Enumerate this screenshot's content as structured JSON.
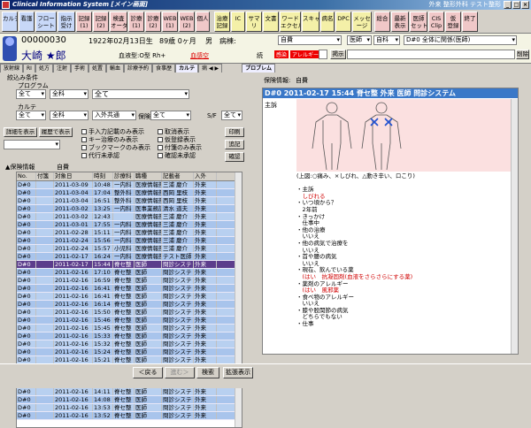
{
  "window": {
    "title": "Clinical Information System  [メイン画面]",
    "right": "外来 整形外科  テスト整形"
  },
  "toolbar": [
    {
      "label": "カルテ",
      "color": "blu"
    },
    {
      "label": "看護",
      "color": "blu"
    },
    {
      "label": "フロー\nシート",
      "color": "blu"
    },
    {
      "label": "指示\n受け",
      "color": "blu"
    },
    {
      "label": "記録\n(1)",
      "color": "pink"
    },
    {
      "label": "記録\n(2)",
      "color": "pink"
    },
    {
      "label": "検査\nオーダ",
      "color": "pink"
    },
    {
      "label": "診療\n(1)",
      "color": "pink"
    },
    {
      "label": "診療\n(2)",
      "color": "pink"
    },
    {
      "label": "WEB\n(1)",
      "color": "pink"
    },
    {
      "label": "WEB\n(2)",
      "color": "pink"
    },
    {
      "label": "個人",
      "color": "pink"
    },
    {
      "label": "治療\n記録",
      "color": "yel"
    },
    {
      "label": "IC",
      "color": "yel"
    },
    {
      "label": "サマ\nリ",
      "color": "yel"
    },
    {
      "label": "文書",
      "color": "yel"
    },
    {
      "label": "ワード\nエクセル",
      "color": "yel"
    },
    {
      "label": "スキャン",
      "color": "yel"
    },
    {
      "label": "病名",
      "color": "yel"
    },
    {
      "label": "DPC",
      "color": "yel"
    },
    {
      "label": "メッセ\nージ",
      "color": "yel"
    },
    {
      "label": "総合",
      "color": "pink"
    },
    {
      "label": "最新\n表示",
      "color": "pink"
    },
    {
      "label": "医師\nセット",
      "color": "pink"
    },
    {
      "label": "CIS\nClip",
      "color": "pink"
    },
    {
      "label": "仮\n登録",
      "color": "pink"
    },
    {
      "label": "終了",
      "color": "pink"
    }
  ],
  "patient": {
    "id": "00000030",
    "dob": "1922年02月13日生",
    "age": "89歳 0ヶ月",
    "sex": "男",
    "disease_label": "病棟:",
    "ward": "自費",
    "name": "大崎 ★郎",
    "blood": "血液型:O型 Rh+",
    "infection": "血感空",
    "warn1": "感染",
    "warn2": "アレルギー",
    "doctor": "医師",
    "dept": "自科",
    "problem": "D#0 全体に関係(医師)",
    "delete_btn": "削除",
    "extra_btn": "掲示",
    "memo_label": "続"
  },
  "tabs": [
    "放射線",
    "RI",
    "処方",
    "注射",
    "手術",
    "処置",
    "輸血",
    "診療予約",
    "食事歴",
    "カルテ",
    "病 ◀ ▶",
    "プロブレム"
  ],
  "left": {
    "filter_label": "絞込み条件",
    "program_label": "プログラム",
    "sel_all": "全て",
    "sel_dept": "全科",
    "sel_all2": "全て",
    "karte_label": "カルテ",
    "k_all": "全て",
    "k_dept": "全科",
    "k_io": "入外共通",
    "insurance_label": "保険",
    "ins_all": "全て",
    "sf_label": "S/F",
    "sf_all": "全て",
    "detail_btn": "詳細を表示",
    "history_btn": "履歴で表示",
    "print_btn": "印刷",
    "add_btn": "追記",
    "confirm_btn": "確認",
    "checks": [
      "手入力記載のみ表示",
      "キー治療のみ表示",
      "ブックマークのみ表示",
      "代行未承認",
      "取消表示",
      "仮登録表示",
      "付箋のみ表示",
      "確認未承認"
    ],
    "insurance_info": "▲保険情報",
    "insurance_value": "自費",
    "grid_headers": [
      "No.",
      "付箋",
      "対象日",
      "時刻",
      "診療科",
      "職種",
      "記載者",
      "入外"
    ],
    "rows": [
      [
        "D#0",
        "",
        "2011-03-09",
        "10:48",
        "一内科",
        "医療情報部",
        "三浦 慶介",
        "外来"
      ],
      [
        "D#0",
        "",
        "2011-03-04",
        "17:04",
        "整外科",
        "医療情報部",
        "西岡 里枝",
        "外来"
      ],
      [
        "D#0",
        "",
        "2011-03-04",
        "16:51",
        "整外科",
        "医療情報部",
        "西岡 里枝",
        "外来"
      ],
      [
        "D#0",
        "",
        "2011-03-02",
        "13:25",
        "一内科",
        "医事業務課",
        "清水 道夫",
        "外来"
      ],
      [
        "D#0",
        "",
        "2011-03-02",
        "12:43",
        "",
        "医療情報部",
        "三浦 慶介",
        "外来"
      ],
      [
        "D#0",
        "",
        "2011-03-01",
        "17:55",
        "一内科",
        "医療情報部",
        "三浦 慶介",
        "外来"
      ],
      [
        "D#0",
        "",
        "2011-02-28",
        "15:11",
        "一内科",
        "医療情報部",
        "三浦 慶介",
        "外来"
      ],
      [
        "D#0",
        "",
        "2011-02-24",
        "15:56",
        "一内科",
        "医療情報部",
        "三浦 慶介",
        "外来"
      ],
      [
        "D#0",
        "",
        "2011-02-24",
        "15:57",
        "小児科",
        "医療情報部",
        "三浦 慶介",
        "外来"
      ],
      [
        "D#0",
        "",
        "2011-02-17",
        "16:24",
        "一内科",
        "医療情報部",
        "テスト医師",
        "外来"
      ],
      [
        "D#0",
        "",
        "2011-02-17",
        "15:44",
        "脊セ整",
        "医師",
        "問診システ",
        "外来"
      ],
      [
        "D#0",
        "",
        "2011-02-16",
        "17:10",
        "脊セ整",
        "医師",
        "問診システ",
        "外来"
      ],
      [
        "D#0",
        "",
        "2011-02-16",
        "16:59",
        "脊セ整",
        "医師",
        "問診システ",
        "外来"
      ],
      [
        "D#0",
        "",
        "2011-02-16",
        "16:41",
        "脊セ整",
        "医師",
        "問診システ",
        "外来"
      ],
      [
        "D#0",
        "",
        "2011-02-16",
        "16:41",
        "脊セ整",
        "医師",
        "問診システ",
        "外来"
      ],
      [
        "D#0",
        "",
        "2011-02-16",
        "16:14",
        "脊セ整",
        "医師",
        "問診システ",
        "外来"
      ],
      [
        "D#0",
        "",
        "2011-02-16",
        "15:50",
        "脊セ整",
        "医師",
        "問診システ",
        "外来"
      ],
      [
        "D#0",
        "",
        "2011-02-16",
        "15:46",
        "脊セ整",
        "医師",
        "問診システ",
        "外来"
      ],
      [
        "D#0",
        "",
        "2011-02-16",
        "15:45",
        "脊セ整",
        "医師",
        "問診システ",
        "外来"
      ],
      [
        "D#0",
        "",
        "2011-02-16",
        "15:33",
        "脊セ整",
        "医師",
        "問診システ",
        "外来"
      ],
      [
        "D#0",
        "",
        "2011-02-16",
        "15:32",
        "脊セ整",
        "医師",
        "問診システ",
        "外来"
      ],
      [
        "D#0",
        "",
        "2011-02-16",
        "15:24",
        "脊セ整",
        "医師",
        "問診システ",
        "外来"
      ],
      [
        "D#0",
        "",
        "2011-02-16",
        "15:21",
        "脊セ整",
        "医師",
        "問診システ",
        "外来"
      ],
      [
        "D#0",
        "",
        "2011-02-16",
        "14:41",
        "脊セ整",
        "医師",
        "問診システ",
        "外来"
      ],
      [
        "D#0",
        "",
        "2011-02-16",
        "14:13",
        "脊セ整",
        "医師",
        "問診システ",
        "外来"
      ],
      [
        "D#0",
        "",
        "2011-02-16",
        "14:13",
        "脊セ整",
        "医師",
        "問診システ",
        "外来"
      ],
      [
        "D#0",
        "",
        "2011-02-16",
        "14:11",
        "脊セ整",
        "医師",
        "問診システ",
        "外来"
      ],
      [
        "D#0",
        "",
        "2011-02-16",
        "14:08",
        "脊セ整",
        "医師",
        "問診システ",
        "外来"
      ],
      [
        "D#0",
        "",
        "2011-02-16",
        "13:53",
        "脊セ整",
        "医師",
        "問診システ",
        "外来"
      ],
      [
        "D#0",
        "",
        "2011-02-16",
        "13:52",
        "脊セ整",
        "医師",
        "問診システ",
        "外来"
      ]
    ],
    "selected_row": 10
  },
  "right": {
    "insurance_label": "保険情報:",
    "insurance_value": "自費",
    "note_header": "D#0  2011-02-17 15:44 脊セ整 外来 医師  問診システム",
    "chief_label": "主訴",
    "note_lines": [
      {
        "t": "(上図:○痛み、×しびれ、△動き辛い、ロこり)",
        "c": ""
      },
      {
        "t": "",
        "c": ""
      },
      {
        "t": "・主訴",
        "c": ""
      },
      {
        "t": "　しびれる",
        "c": "red"
      },
      {
        "t": "・いつ頃から？",
        "c": ""
      },
      {
        "t": "　2年前",
        "c": ""
      },
      {
        "t": "・きっかけ",
        "c": ""
      },
      {
        "t": "　仕事中",
        "c": ""
      },
      {
        "t": "・他の治療",
        "c": ""
      },
      {
        "t": "　いいえ",
        "c": ""
      },
      {
        "t": "・他の病気で治療を",
        "c": ""
      },
      {
        "t": "　いいえ",
        "c": ""
      },
      {
        "t": "・首や腰の病気",
        "c": ""
      },
      {
        "t": "　いいえ",
        "c": ""
      },
      {
        "t": "・現在、飲んでいる薬",
        "c": ""
      },
      {
        "t": "　(はい　抗凝固剤(血液をさらさらにする薬)",
        "c": "red"
      },
      {
        "t": "・薬剤のアレルギー",
        "c": ""
      },
      {
        "t": "　(はい　風邪薬",
        "c": "red"
      },
      {
        "t": "・食べ物のアレルギー",
        "c": ""
      },
      {
        "t": "　いいえ",
        "c": ""
      },
      {
        "t": "・膝や股関節の病気",
        "c": ""
      },
      {
        "t": "　どちらでもない",
        "c": ""
      },
      {
        "t": "・仕事",
        "c": ""
      }
    ]
  },
  "bottom": {
    "back": "＜戻る",
    "next": "進む＞",
    "search": "検索",
    "expand": "拡張表示"
  }
}
